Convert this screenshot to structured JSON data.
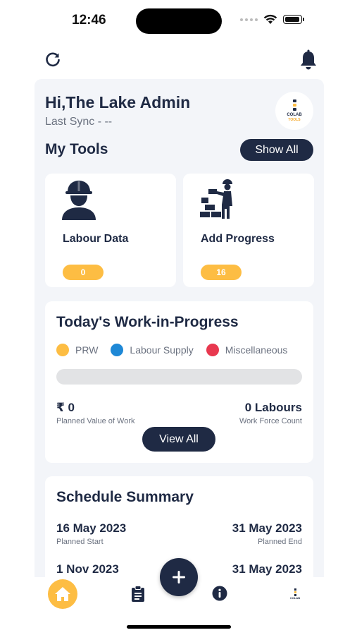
{
  "status": {
    "time": "12:46"
  },
  "header": {
    "greeting": "Hi,The Lake Admin",
    "last_sync": "Last Sync - --",
    "logo_text": "COLAB",
    "logo_subtext": "TOOLS"
  },
  "tools": {
    "title": "My Tools",
    "show_all_label": "Show All",
    "items": [
      {
        "label": "Labour Data",
        "count": "0",
        "icon": "worker-icon"
      },
      {
        "label": "Add Progress",
        "count": "16",
        "icon": "bricklayer-icon"
      }
    ]
  },
  "wip": {
    "title": "Today's Work-in-Progress",
    "legend": [
      {
        "label": "PRW",
        "color": "#fdbd43"
      },
      {
        "label": "Labour Supply",
        "color": "#1e88d6"
      },
      {
        "label": "Miscellaneous",
        "color": "#e8384f"
      }
    ],
    "progress": 0,
    "planned_value": "₹ 0",
    "planned_value_label": "Planned Value of Work",
    "labour_count": "0 Labours",
    "labour_count_label": "Work Force Count",
    "view_all_label": "View All"
  },
  "schedule": {
    "title": "Schedule Summary",
    "planned_start": "16 May 2023",
    "planned_start_label": "Planned Start",
    "planned_end": "31 May 2023",
    "planned_end_label": "Planned End",
    "row2_left": "1 Nov 2023",
    "row2_right": "31 May 2023"
  },
  "tabbar": {
    "items": [
      "home-icon",
      "clipboard-icon",
      "info-icon",
      "profile-logo-icon"
    ]
  },
  "colors": {
    "primary": "#1f2a44",
    "accent": "#fdbd43",
    "background": "#f3f5f9"
  }
}
